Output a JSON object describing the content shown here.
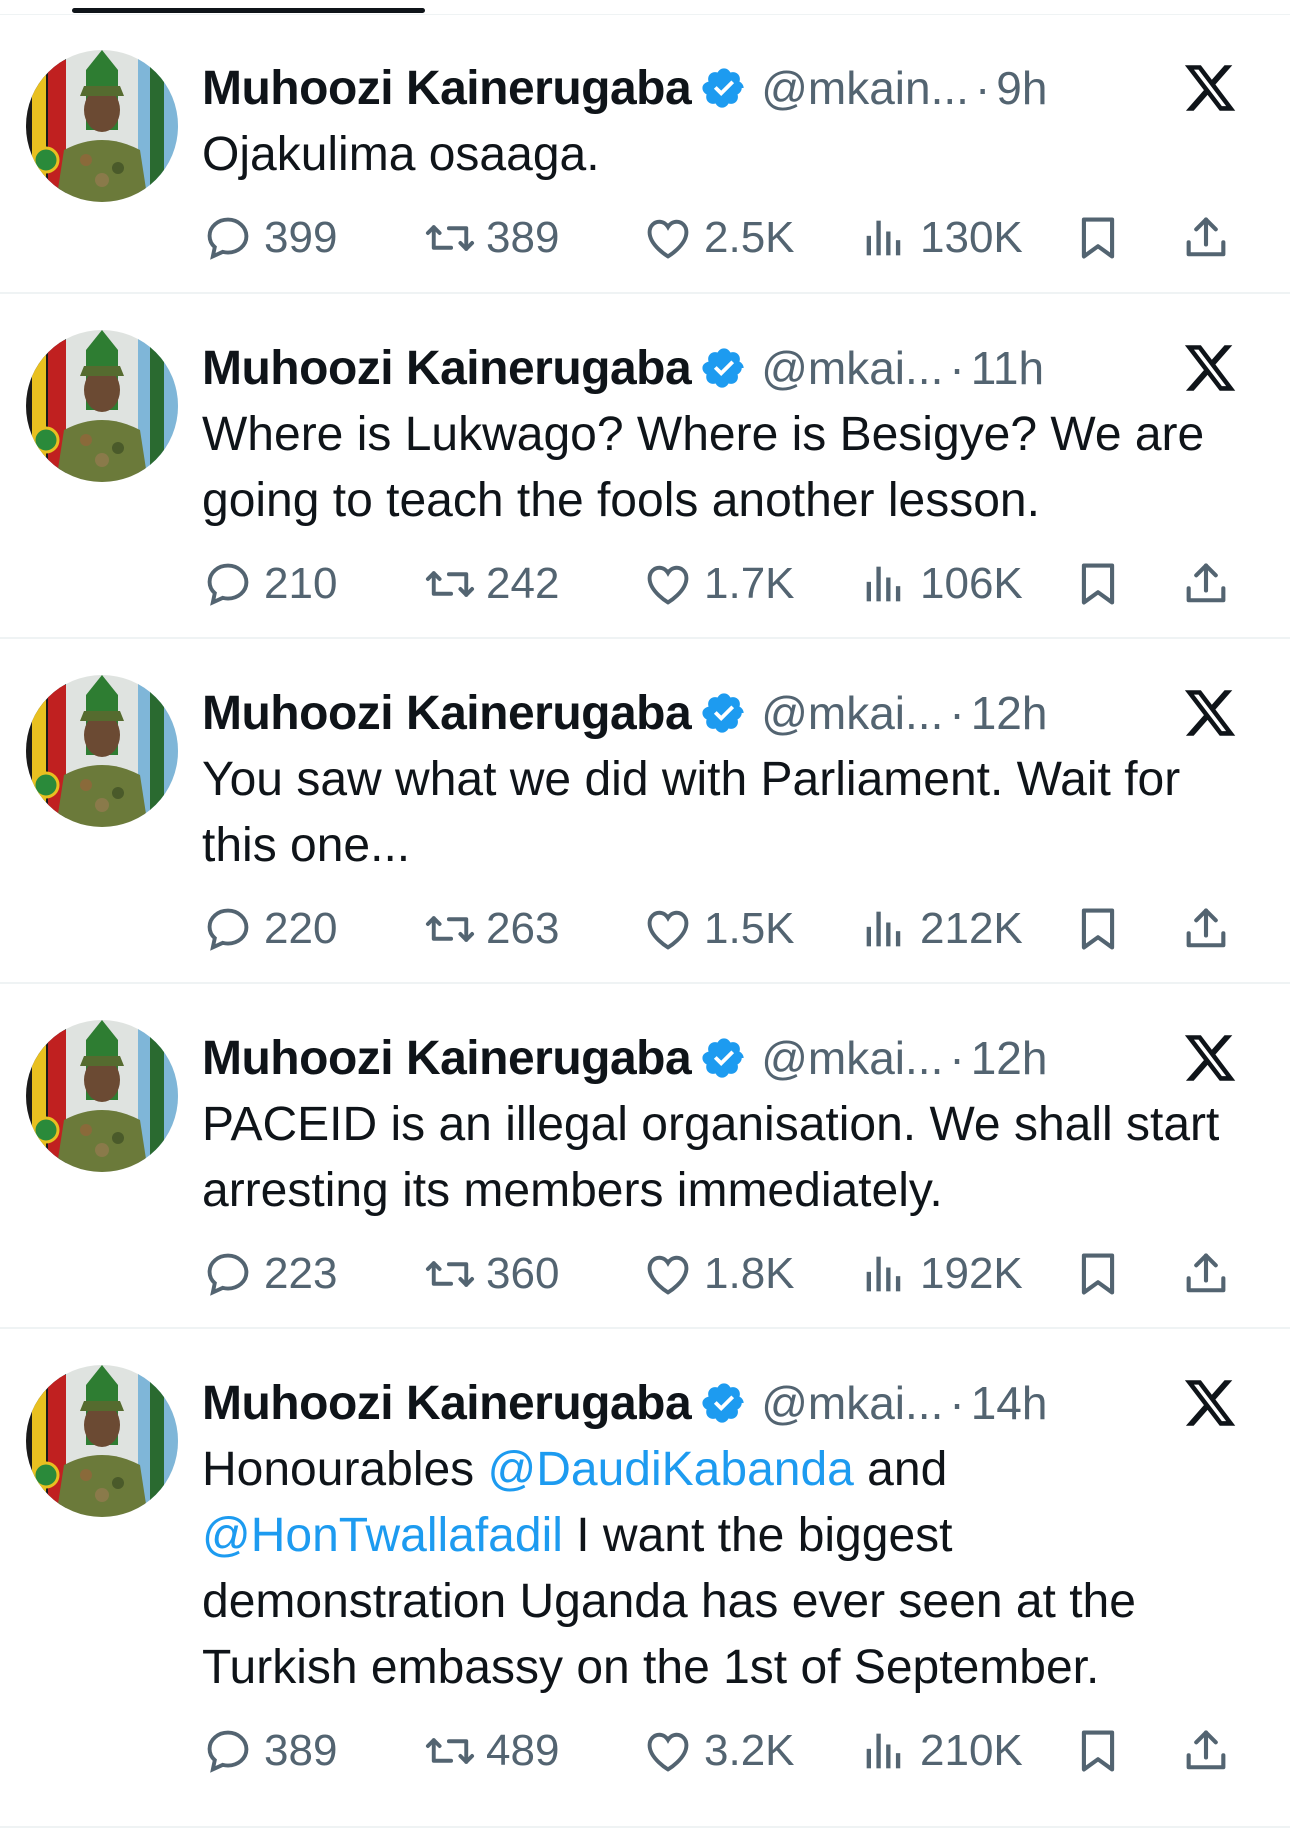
{
  "tweets": [
    {
      "name": "Muhoozi Kainerugaba",
      "handle": "@mkain...",
      "time": "9h",
      "segments": [
        {
          "t": "Ojakulima osaaga.",
          "m": false
        }
      ],
      "replies": "399",
      "reposts": "389",
      "likes": "2.5K",
      "views": "130K"
    },
    {
      "name": "Muhoozi Kainerugaba",
      "handle": "@mkai...",
      "time": "11h",
      "segments": [
        {
          "t": "Where is Lukwago? Where is Besigye? We are going to teach the fools another lesson.",
          "m": false
        }
      ],
      "replies": "210",
      "reposts": "242",
      "likes": "1.7K",
      "views": "106K"
    },
    {
      "name": "Muhoozi Kainerugaba",
      "handle": "@mkai...",
      "time": "12h",
      "segments": [
        {
          "t": "You saw what we did with Parliament. Wait for this one...",
          "m": false
        }
      ],
      "replies": "220",
      "reposts": "263",
      "likes": "1.5K",
      "views": "212K"
    },
    {
      "name": "Muhoozi Kainerugaba",
      "handle": "@mkai...",
      "time": "12h",
      "segments": [
        {
          "t": "PACEID is an illegal organisation. We shall start arresting its members immediately.",
          "m": false
        }
      ],
      "replies": "223",
      "reposts": "360",
      "likes": "1.8K",
      "views": "192K"
    },
    {
      "name": "Muhoozi Kainerugaba",
      "handle": "@mkai...",
      "time": "14h",
      "segments": [
        {
          "t": "Honourables ",
          "m": false
        },
        {
          "t": "@DaudiKabanda",
          "m": true
        },
        {
          "t": " and ",
          "m": false
        },
        {
          "t": "@HonTwallafadil",
          "m": true
        },
        {
          "t": " I want the biggest demonstration Uganda has ever seen at the Turkish embassy on the 1st of September.",
          "m": false
        }
      ],
      "replies": "389",
      "reposts": "489",
      "likes": "3.2K",
      "views": "210K"
    }
  ],
  "colors": {
    "text": "#0f1419",
    "muted": "#536471",
    "link": "#1d9bf0",
    "verified": "#1d9bf0",
    "divider": "#eff3f4"
  },
  "icons": [
    "reply-icon",
    "repost-icon",
    "like-icon",
    "views-icon",
    "bookmark-icon",
    "share-icon",
    "x-logo-icon",
    "verified-badge-icon"
  ]
}
